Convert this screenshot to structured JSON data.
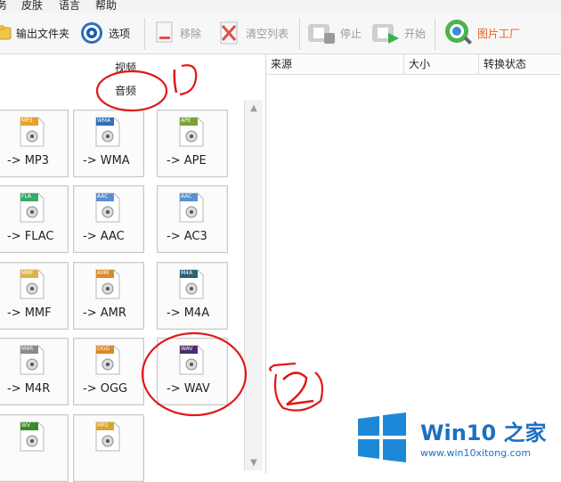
{
  "menubar": {
    "items": [
      "务",
      "皮肤",
      "语言",
      "帮助"
    ]
  },
  "toolbar": {
    "output_folder": "输出文件夹",
    "options": "选项",
    "remove": "移除",
    "clear_list": "清空列表",
    "stop": "停止",
    "start": "开始",
    "picture_factory": "图片工厂"
  },
  "categories": {
    "video": "视频",
    "audio": "音频"
  },
  "formats": [
    {
      "badge": "MP3",
      "label": "-> MP3",
      "color": "#e8a02a"
    },
    {
      "badge": "WMA",
      "label": "-> WMA",
      "color": "#2f6fb6"
    },
    {
      "badge": "APE",
      "label": "-> APE",
      "color": "#7aa03a"
    },
    {
      "badge": "FLA",
      "label": "-> FLAC",
      "color": "#3aa86b"
    },
    {
      "badge": "AAC",
      "label": "-> AAC",
      "color": "#5b8fd0"
    },
    {
      "badge": "AAC",
      "label": "-> AC3",
      "color": "#5b8fd0"
    },
    {
      "badge": "MMF",
      "label": "-> MMF",
      "color": "#d9b34a"
    },
    {
      "badge": "AMR",
      "label": "-> AMR",
      "color": "#d98a2a"
    },
    {
      "badge": "M4A",
      "label": "-> M4A",
      "color": "#2f5f7a"
    },
    {
      "badge": "M4R",
      "label": "-> M4R",
      "color": "#8a8a8a"
    },
    {
      "badge": "OGG",
      "label": "-> OGG",
      "color": "#d98a2a"
    },
    {
      "badge": "WAV",
      "label": "-> WAV",
      "color": "#4a2f6a"
    },
    {
      "badge": "WV",
      "label": "",
      "color": "#3a8a2a"
    },
    {
      "badge": "MP2",
      "label": "",
      "color": "#d9a52a"
    }
  ],
  "list_columns": [
    "来源",
    "大小",
    "转换状态"
  ],
  "annotations": {
    "first": "1",
    "second": "2"
  },
  "watermark": {
    "title": "Win10 之家",
    "url": "www.win10xitong.com"
  }
}
